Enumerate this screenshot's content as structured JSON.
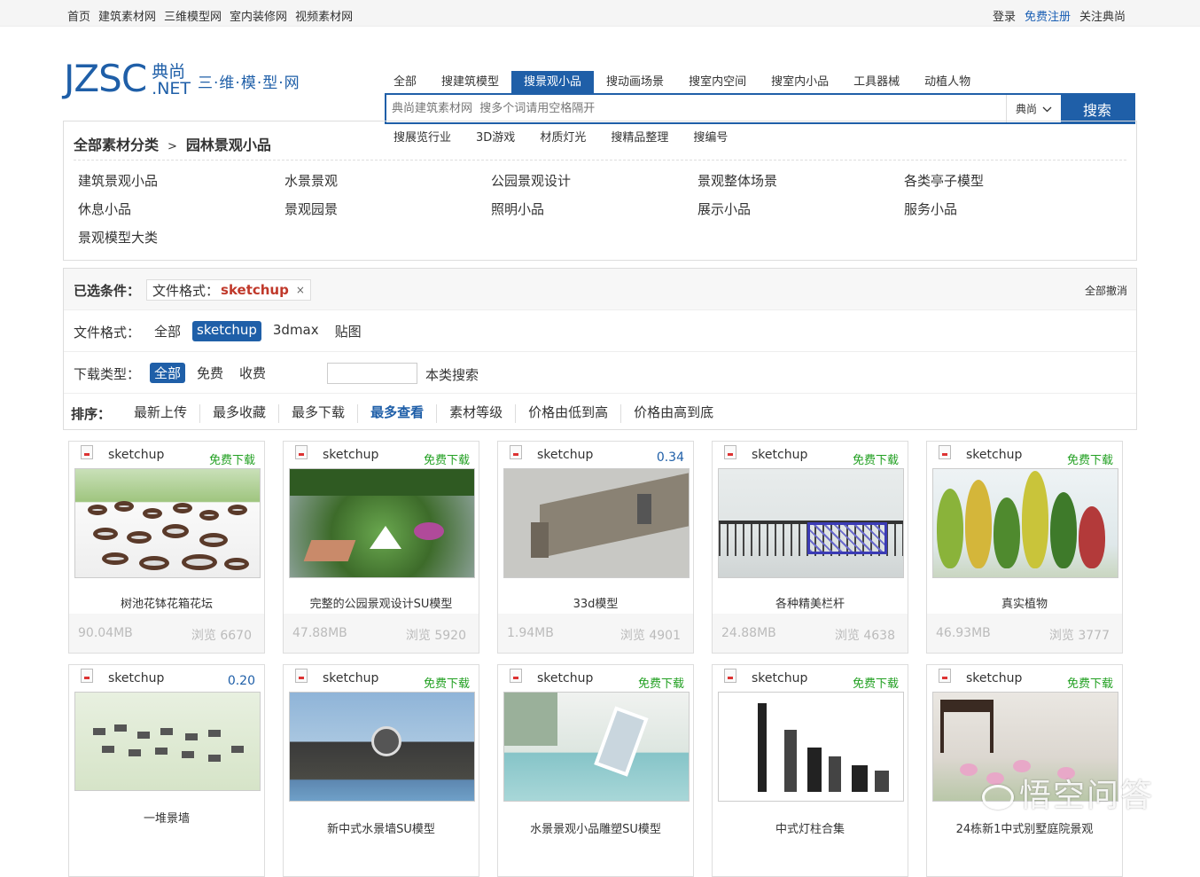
{
  "topbar": {
    "links": [
      "首页",
      "建筑素材网",
      "三维模型网",
      "室内装修网",
      "视频素材网"
    ],
    "login": "登录",
    "register": "免费注册",
    "follow": "关注典尚"
  },
  "logo": {
    "jzsc": "JZSC",
    "cn": "典尚",
    "net": ".NET",
    "slogan": "三·维·模·型·网"
  },
  "search": {
    "tabs": [
      "全部",
      "搜建筑模型",
      "搜景观小品",
      "搜动画场景",
      "搜室内空间",
      "搜室内小品",
      "工具器械",
      "动植人物"
    ],
    "active_tab": "搜景观小品",
    "placeholder": "典尚建筑素材网  搜多个词请用空格隔开",
    "scope": "典尚",
    "button": "搜索",
    "subtabs": [
      "搜展览行业",
      "3D游戏",
      "材质灯光",
      "搜精品整理",
      "搜编号"
    ]
  },
  "categories": {
    "root": "全部素材分类",
    "separator": ">",
    "current": "园林景观小品",
    "items": [
      "建筑景观小品",
      "水景景观",
      "公园景观设计",
      "景观整体场景",
      "各类亭子模型",
      "休息小品",
      "景观园景",
      "照明小品",
      "展示小品",
      "服务小品",
      "景观模型大类"
    ]
  },
  "filters": {
    "selected_label": "已选条件：",
    "chip_key": "文件格式：",
    "chip_value": "sketchup",
    "chip_remove": "×",
    "clear_all": "全部撤消",
    "format_label": "文件格式：",
    "format_options": [
      "全部",
      "sketchup",
      "3dmax",
      "贴图"
    ],
    "format_selected": "sketchup",
    "download_label": "下载类型：",
    "download_options": [
      "全部",
      "免费",
      "收费"
    ],
    "download_selected": "全部",
    "local_search": "本类搜索",
    "sort_label": "排序：",
    "sort_options": [
      "最新上传",
      "最多收藏",
      "最多下载",
      "最多查看",
      "素材等级",
      "价格由低到高",
      "价格由高到底"
    ],
    "sort_selected": "最多查看"
  },
  "cards": [
    {
      "format": "sketchup",
      "price": "免费下载",
      "title": "树池花钵花箱花坛",
      "size": "90.04MB",
      "views": "浏览 6670"
    },
    {
      "format": "sketchup",
      "price": "免费下载",
      "title": "完整的公园景观设计SU模型",
      "size": "47.88MB",
      "views": "浏览 5920"
    },
    {
      "format": "sketchup",
      "price": "0.34",
      "title": "33d模型",
      "size": "1.94MB",
      "views": "浏览 4901"
    },
    {
      "format": "sketchup",
      "price": "免费下载",
      "title": "各种精美栏杆",
      "size": "24.88MB",
      "views": "浏览 4638"
    },
    {
      "format": "sketchup",
      "price": "免费下载",
      "title": "真实植物",
      "size": "46.93MB",
      "views": "浏览 3777"
    },
    {
      "format": "sketchup",
      "price": "0.20",
      "title": "一堆景墙",
      "size": "",
      "views": ""
    },
    {
      "format": "sketchup",
      "price": "免费下载",
      "title": "新中式水景墙SU模型",
      "size": "",
      "views": ""
    },
    {
      "format": "sketchup",
      "price": "免费下载",
      "title": "水景景观小品雕塑SU模型",
      "size": "",
      "views": ""
    },
    {
      "format": "sketchup",
      "price": "免费下载",
      "title": "中式灯柱合集",
      "size": "",
      "views": ""
    },
    {
      "format": "sketchup",
      "price": "免费下载",
      "title": "24栋新1中式别墅庭院景观",
      "size": "",
      "views": ""
    }
  ],
  "watermark": "悟空问答",
  "colors": {
    "brand": "#1f5fa8",
    "free": "#22a022",
    "selected_value": "#c0392b"
  }
}
